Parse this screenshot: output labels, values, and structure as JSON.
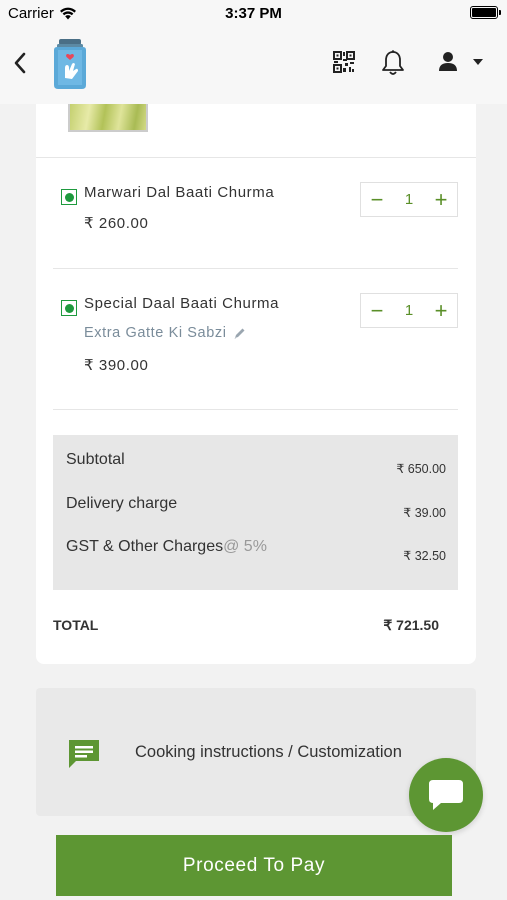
{
  "status_bar": {
    "carrier": "Carrier",
    "time": "3:37 PM"
  },
  "header": {
    "back_icon": "chevron-left-icon",
    "logo_icon": "jar-logo-icon",
    "qr_icon": "qr-code-icon",
    "bell_icon": "bell-icon",
    "user_icon": "user-icon"
  },
  "cart": {
    "items": [
      {
        "name": "Marwari Dal Baati Churma",
        "price": "₹ 260.00",
        "quantity": "1",
        "addon": ""
      },
      {
        "name": "Special Daal Baati Churma",
        "price": "₹ 390.00",
        "quantity": "1",
        "addon": "Extra Gatte Ki Sabzi"
      }
    ],
    "stepper": {
      "minus": "−",
      "plus": "+"
    }
  },
  "summary": {
    "subtotal_label": "Subtotal",
    "subtotal_value": "₹ 650.00",
    "delivery_label": "Delivery charge",
    "delivery_value": "₹ 39.00",
    "gst_label": "GST & Other Charges",
    "gst_rate": "@ 5%",
    "gst_value": "₹ 32.50",
    "total_label": "TOTAL",
    "total_value": "₹ 721.50"
  },
  "instructions": {
    "label": "Cooking instructions / Customization"
  },
  "actions": {
    "proceed_label": "Proceed To Pay"
  },
  "colors": {
    "accent": "#5d9633",
    "veg": "#1e9a3e",
    "background": "#f2f2f2"
  }
}
